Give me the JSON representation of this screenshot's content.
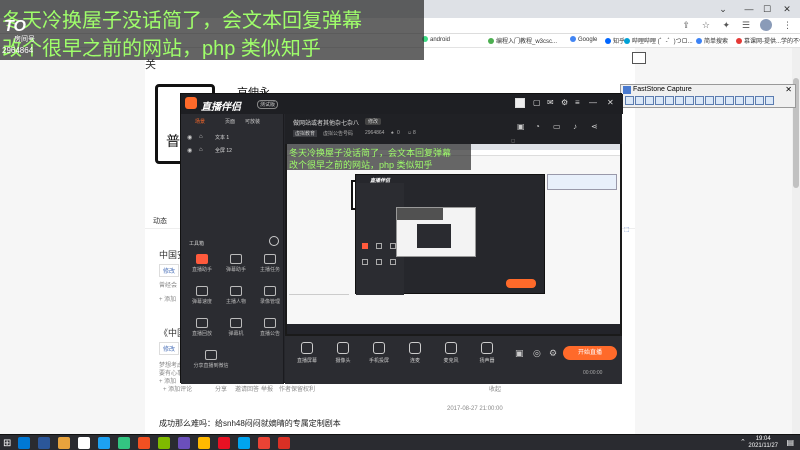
{
  "caption": {
    "line1": "冬天冷换屋子没话简了，会文本回复弹幕",
    "line2": "改个很早之前的网站，php 类似知乎",
    "badge_text": "TO",
    "badge_sub": "房间号",
    "room_number": "2964864"
  },
  "browser": {
    "bookmarks": [
      {
        "label": "android",
        "color": "#3ddc84"
      },
      {
        "label": "编程入门教程_w3csc...",
        "color": "#4caf50"
      },
      {
        "label": "Google",
        "color": "#4285f4"
      },
      {
        "label": "知乎",
        "color": "#0066ff"
      },
      {
        "label": "哔哩哔哩 (゜-゜)つロ...",
        "color": "#00a1d6"
      },
      {
        "label": "简单搜索",
        "color": "#3b82f6"
      },
      {
        "label": "慕课网-提供...学的不仅...",
        "color": "#e53935"
      }
    ]
  },
  "faststone": {
    "title": "FastStone Capture"
  },
  "profile": {
    "name": "京伸永",
    "glyph": "普"
  },
  "page": {
    "tab_dynamic": "动态",
    "item1_title": "中国安",
    "item1_edit": "修改",
    "item1_meta": "曾经会",
    "item1_add": "+ 添加",
    "item2_title": "《中国",
    "item2_edit": "修改",
    "item2_meta1": "梦想考虑",
    "item2_meta2": "要有心事",
    "item2_add": "+ 添加",
    "actions": [
      "+ 添加评论",
      "分享",
      "邀请回答",
      "举报",
      "作者保留权利"
    ],
    "collect": "收起",
    "date": "2017-08-27 21:00:00",
    "footer_title": "成功那么难吗：给snh48闷闷就嫡晴的专属定制剧本"
  },
  "app": {
    "brand": "直播伴侣",
    "version": "测试版",
    "tabs": [
      "场景",
      "页面",
      "可放装"
    ],
    "sources": [
      "文本 1",
      "全屏 12"
    ],
    "room_title": "做网站或者其他杂七杂八",
    "room_tag": "修改",
    "room_category": "虚拟教育",
    "room_id_label": "虚拟公告号码",
    "room_id": "2964864",
    "likes": "0",
    "viewers": "8",
    "toolbox_label": "工具箱",
    "tools": [
      {
        "label": "直播助手",
        "accent": true
      },
      {
        "label": "弹幕助手",
        "accent": false
      },
      {
        "label": "主播任务",
        "accent": false
      },
      {
        "label": "弹幕速度",
        "accent": false
      },
      {
        "label": "主播人物",
        "accent": false
      },
      {
        "label": "录像管理",
        "accent": false
      },
      {
        "label": "直播回放",
        "accent": false
      },
      {
        "label": "弹幕机",
        "accent": false
      },
      {
        "label": "直播公告",
        "accent": false
      },
      {
        "label": "分享直播到微信",
        "accent": false
      }
    ],
    "bottom_actions": [
      "直播屏幕",
      "摄像头",
      "手机投屏",
      "连麦",
      "麦克风",
      "扬声器"
    ],
    "go_live": "开始直播",
    "timer": "00:00:00"
  },
  "preview": {
    "line1": "冬天冷换屋子没话简了，会文本回复弹幕",
    "line2": "改个很早之前的网站，php 类似知乎",
    "nested_brand": "直播伴侣"
  },
  "taskbar": {
    "time": "19:04",
    "date": "2021/11/27",
    "icons": [
      "#0078d4",
      "#2b579a",
      "#e8a33d",
      "#ffffff",
      "#1da1f2",
      "#33c481",
      "#f25022",
      "#7fba00",
      "#6b4fbb",
      "#ffb900",
      "#e81123",
      "#00a4ef",
      "#ea4335",
      "#d93025"
    ]
  }
}
